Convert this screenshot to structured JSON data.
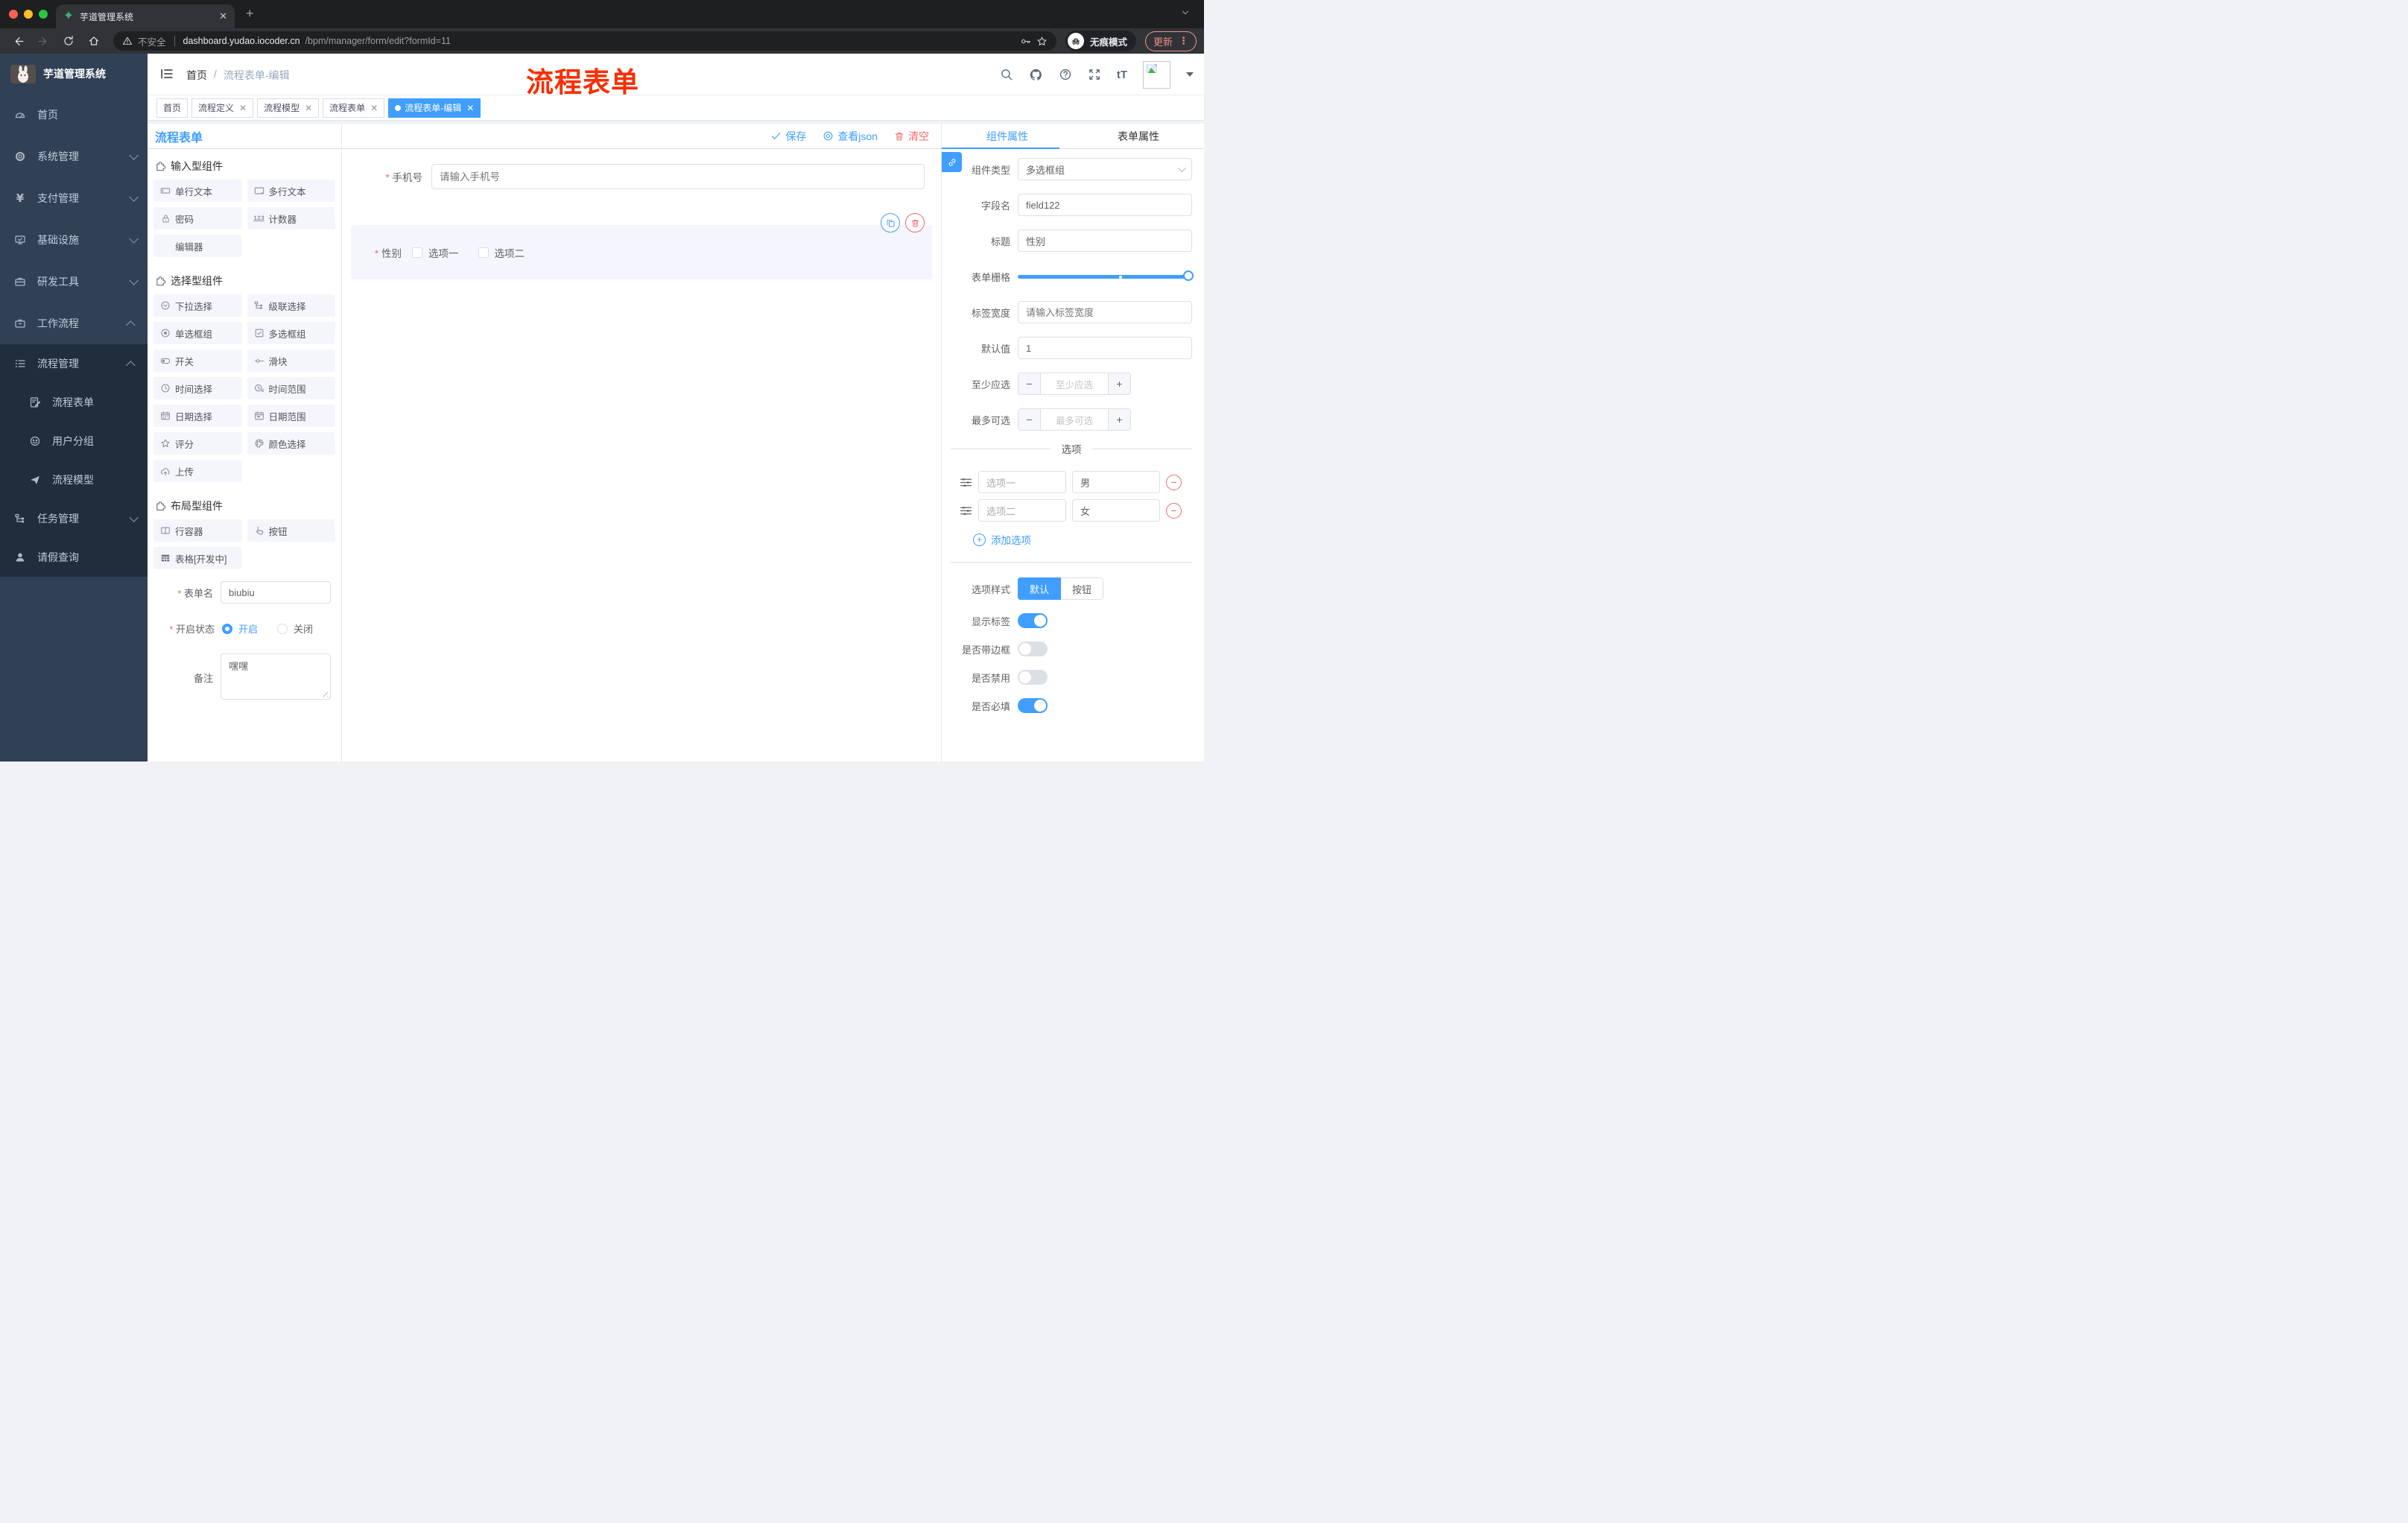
{
  "browser": {
    "tab_title": "芋道管理系统",
    "not_secure": "不安全",
    "url_host": "dashboard.yudao.iocoder.cn",
    "url_path": "/bpm/manager/form/edit?formId=11",
    "incognito_label": "无痕模式",
    "update_label": "更新"
  },
  "sidebar": {
    "title": "芋道管理系统",
    "items": [
      {
        "label": "首页"
      },
      {
        "label": "系统管理"
      },
      {
        "label": "支付管理"
      },
      {
        "label": "基础设施"
      },
      {
        "label": "研发工具"
      },
      {
        "label": "工作流程"
      }
    ],
    "submenu": [
      {
        "label": "流程管理"
      },
      {
        "label": "流程表单"
      },
      {
        "label": "用户分组"
      },
      {
        "label": "流程模型"
      },
      {
        "label": "任务管理"
      },
      {
        "label": "请假查询"
      }
    ]
  },
  "header": {
    "breadcrumb_home": "首页",
    "breadcrumb_sep": "/",
    "breadcrumb_current": "流程表单-编辑",
    "annotation": "流程表单"
  },
  "tags": [
    {
      "label": "首页"
    },
    {
      "label": "流程定义"
    },
    {
      "label": "流程模型"
    },
    {
      "label": "流程表单"
    },
    {
      "label": "流程表单-编辑"
    }
  ],
  "designer": {
    "panel_title": "流程表单",
    "toolbar": {
      "save": "保存",
      "view_json": "查看json",
      "clear": "清空"
    },
    "sections": {
      "input": {
        "title": "输入型组件",
        "items": [
          "单行文本",
          "多行文本",
          "密码",
          "计数器",
          "编辑器"
        ]
      },
      "select": {
        "title": "选择型组件",
        "items": [
          "下拉选择",
          "级联选择",
          "单选框组",
          "多选框组",
          "开关",
          "滑块",
          "时间选择",
          "时间范围",
          "日期选择",
          "日期范围",
          "评分",
          "颜色选择",
          "上传"
        ]
      },
      "layout": {
        "title": "布局型组件",
        "items": [
          "行容器",
          "按钮",
          "表格[开发中]"
        ]
      }
    },
    "form": {
      "name_label": "表单名",
      "name_value": "biubiu",
      "status_label": "开启状态",
      "status_on": "开启",
      "status_off": "关闭",
      "remark_label": "备注",
      "remark_value": "嘿嘿"
    }
  },
  "canvas": {
    "phone_label": "手机号",
    "phone_placeholder": "请输入手机号",
    "gender_label": "性别",
    "gender_options": [
      "选项一",
      "选项二"
    ]
  },
  "props": {
    "tabs": [
      "组件属性",
      "表单属性"
    ],
    "component_type_label": "组件类型",
    "component_type_value": "多选框组",
    "field_name_label": "字段名",
    "field_name_value": "field122",
    "title_label": "标题",
    "title_value": "性别",
    "grid_label": "表单栅格",
    "label_width_label": "标签宽度",
    "label_width_placeholder": "请输入标签宽度",
    "default_label": "默认值",
    "default_value": "1",
    "min_label": "至少应选",
    "min_placeholder": "至少应选",
    "max_label": "最多可选",
    "max_placeholder": "最多可选",
    "options_title": "选项",
    "options": [
      {
        "name": "选项一",
        "value": "男"
      },
      {
        "name": "选项二",
        "value": "女"
      }
    ],
    "add_option": "添加选项",
    "style_label": "选项样式",
    "style_default": "默认",
    "style_button": "按钮",
    "switches": [
      {
        "label": "显示标签"
      },
      {
        "label": "是否带边框"
      },
      {
        "label": "是否禁用"
      },
      {
        "label": "是否必填"
      }
    ]
  }
}
